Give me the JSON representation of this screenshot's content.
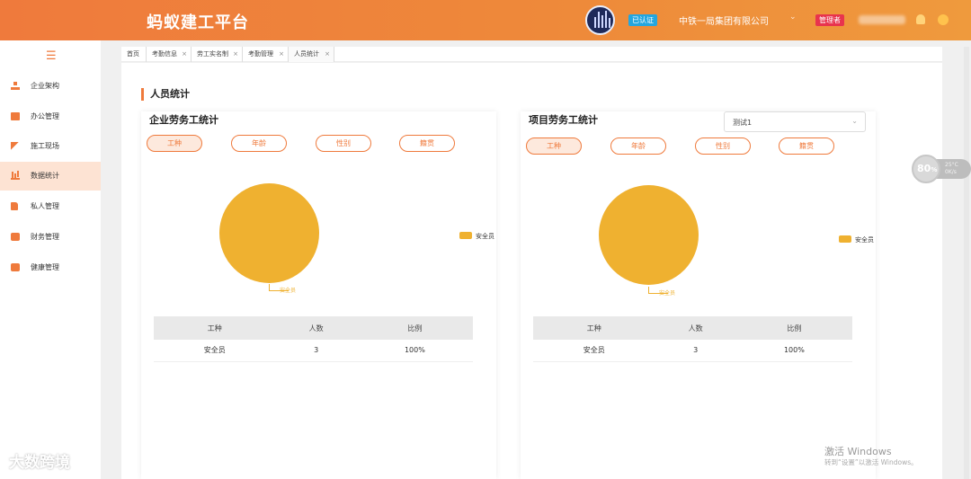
{
  "header": {
    "brand": "蚂蚁建工平台",
    "verified_badge": "已认证",
    "company": "中铁一局集团有限公司",
    "admin_badge": "管理者",
    "chevron_icon": "chevron-down-icon"
  },
  "sidebar": {
    "menu_icon": "☰",
    "items": [
      {
        "label": "企业架构",
        "icon": "org-chart-icon"
      },
      {
        "label": "办公管理",
        "icon": "briefcase-icon"
      },
      {
        "label": "施工现场",
        "icon": "hammer-icon"
      },
      {
        "label": "数据统计",
        "icon": "bar-chart-icon",
        "active": true
      },
      {
        "label": "私人管理",
        "icon": "document-icon"
      },
      {
        "label": "财务管理",
        "icon": "wallet-icon"
      },
      {
        "label": "健康管理",
        "icon": "health-kit-icon"
      }
    ]
  },
  "tabs": [
    {
      "label": "首页",
      "closable": false
    },
    {
      "label": "考勤信息",
      "closable": true
    },
    {
      "label": "劳工实名制",
      "closable": true
    },
    {
      "label": "考勤管理",
      "closable": true
    },
    {
      "label": "人员统计",
      "closable": true
    }
  ],
  "page": {
    "section_title": "人员统计"
  },
  "panels": [
    {
      "title": "企业劳务工统计",
      "filters": [
        "工种",
        "年龄",
        "性别",
        "籍贯"
      ],
      "active_filter": "工种",
      "legend": "安全员",
      "pie_label": "安全员",
      "table": {
        "headers": [
          "工种",
          "人数",
          "比例"
        ],
        "rows": [
          [
            "安全员",
            "3",
            "100%"
          ]
        ]
      }
    },
    {
      "title": "项目劳务工统计",
      "project_select": "测试1",
      "filters": [
        "工种",
        "年龄",
        "性别",
        "籍贯"
      ],
      "active_filter": "工种",
      "legend": "安全员",
      "pie_label": "安全员",
      "table": {
        "headers": [
          "工种",
          "人数",
          "比例"
        ],
        "rows": [
          [
            "安全员",
            "3",
            "100%"
          ]
        ]
      }
    }
  ],
  "chart_data": [
    {
      "type": "pie",
      "categories": [
        "安全员"
      ],
      "values": [
        3
      ],
      "title": "企业劳务工统计",
      "legend_position": "right",
      "color": "#efb130"
    },
    {
      "type": "pie",
      "categories": [
        "安全员"
      ],
      "values": [
        3
      ],
      "title": "项目劳务工统计",
      "legend_position": "right",
      "color": "#efb130"
    }
  ],
  "overlay": {
    "gauge_percent": "80",
    "gauge_unit": "%",
    "gauge_line1": "25°C",
    "gauge_line2": "0K/s",
    "watermark": "大数跨境",
    "windows_activate_title": "激活 Windows",
    "windows_activate_hint": "转到“设置”以激活 Windows。"
  },
  "colors": {
    "accent": "#ef7a3c",
    "pie": "#efb130",
    "verified": "#24a6df",
    "admin": "#e8344e"
  }
}
